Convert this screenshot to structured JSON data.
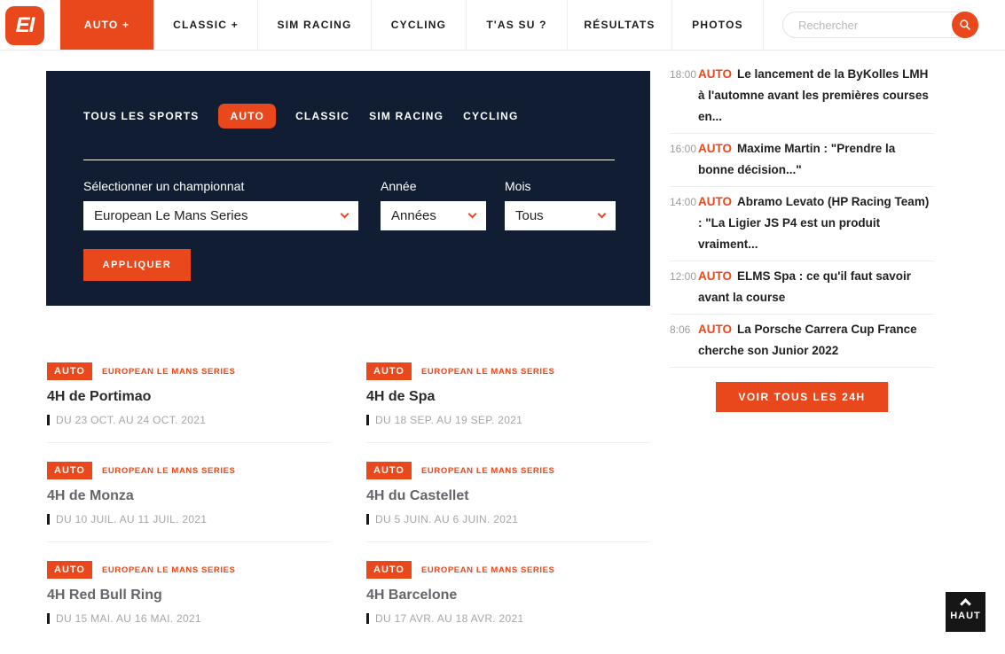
{
  "colors": {
    "accent": "#e8481b",
    "panel_bg": "#111d33",
    "title_dark": "#2b2b2e",
    "title_visited": "#63666b",
    "date_gray": "#a6a6a6",
    "time_gray": "#9b9b9b",
    "divider": "#ededed",
    "back_to_top_bg": "#161616"
  },
  "header": {
    "logo_text": "EI",
    "nav_items": [
      {
        "label": "AUTO +",
        "active": true
      },
      {
        "label": "CLASSIC +",
        "active": false
      },
      {
        "label": "SIM RACING",
        "active": false
      },
      {
        "label": "CYCLING",
        "active": false
      },
      {
        "label": "T'AS SU ?",
        "active": false
      },
      {
        "label": "RÉSULTATS",
        "active": false
      },
      {
        "label": "PHOTOS",
        "active": false
      }
    ],
    "search": {
      "placeholder": "Rechercher",
      "value": ""
    }
  },
  "filter_panel": {
    "tabs": [
      {
        "label": "TOUS LES SPORTS",
        "active": false
      },
      {
        "label": "AUTO",
        "active": true
      },
      {
        "label": "CLASSIC",
        "active": false
      },
      {
        "label": "SIM RACING",
        "active": false
      },
      {
        "label": "CYCLING",
        "active": false
      }
    ],
    "championship": {
      "label": "Sélectionner un championnat",
      "value": "European Le Mans Series"
    },
    "year": {
      "label": "Année",
      "value": "Années"
    },
    "month": {
      "label": "Mois",
      "value": "Tous"
    },
    "apply_label": "APPLIQUER"
  },
  "news_feed": {
    "items": [
      {
        "time": "18:00",
        "tag": "AUTO",
        "title": "Le lancement de la ByKolles LMH à l'automne avant les premières courses en..."
      },
      {
        "time": "16:00",
        "tag": "AUTO",
        "title": "Maxime Martin : \"Prendre la bonne décision...\""
      },
      {
        "time": "14:00",
        "tag": "AUTO",
        "title": "Abramo Levato (HP Racing Team) : \"La Ligier JS P4 est un produit vraiment..."
      },
      {
        "time": "12:00",
        "tag": "AUTO",
        "title": "ELMS Spa : ce qu'il faut savoir avant la course"
      },
      {
        "time": "8:06",
        "tag": "AUTO",
        "title": "La Porsche Carrera Cup France cherche son Junior 2022"
      }
    ],
    "see_all_label": "VOIR TOUS LES 24H"
  },
  "events": {
    "left": [
      {
        "tag": "AUTO",
        "series": "EUROPEAN LE MANS SERIES",
        "title": "4H de Portimao",
        "title_color": "#2b2b2e",
        "date": "DU 23 OCT. AU 24 OCT. 2021"
      },
      {
        "tag": "AUTO",
        "series": "EUROPEAN LE MANS SERIES",
        "title": "4H de Monza",
        "title_color": "#63666b",
        "date": "DU 10 JUIL. AU 11 JUIL. 2021"
      },
      {
        "tag": "AUTO",
        "series": "EUROPEAN LE MANS SERIES",
        "title": "4H Red Bull Ring",
        "title_color": "#63666b",
        "date": "DU 15 MAI. AU 16 MAI. 2021"
      }
    ],
    "right": [
      {
        "tag": "AUTO",
        "series": "EUROPEAN LE MANS SERIES",
        "title": "4H de Spa",
        "title_color": "#2b2b2e",
        "date": "DU 18 SEP. AU 19 SEP. 2021"
      },
      {
        "tag": "AUTO",
        "series": "EUROPEAN LE MANS SERIES",
        "title": "4H du Castellet",
        "title_color": "#63666b",
        "date": "DU 5 JUIN. AU 6 JUIN. 2021"
      },
      {
        "tag": "AUTO",
        "series": "EUROPEAN LE MANS SERIES",
        "title": "4H Barcelone",
        "title_color": "#63666b",
        "date": "DU 17 AVR. AU 18 AVR. 2021"
      }
    ]
  },
  "back_to_top": {
    "label": "HAUT"
  }
}
